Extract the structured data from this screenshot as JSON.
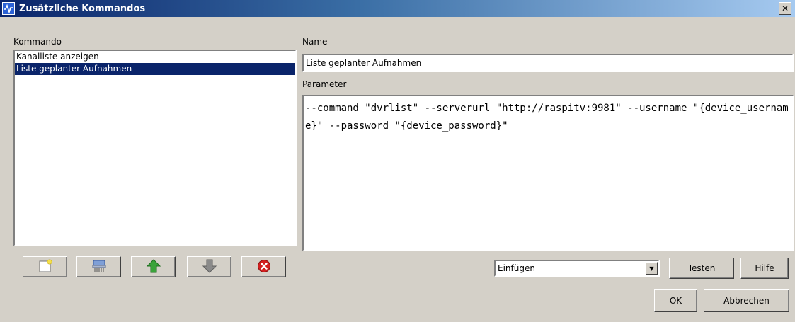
{
  "window": {
    "title": "Zusätzliche Kommandos",
    "close_glyph": "✕"
  },
  "commands": {
    "label": "Kommando",
    "items": [
      {
        "label": "Kanalliste anzeigen",
        "selected": false
      },
      {
        "label": "Liste geplanter Aufnahmen",
        "selected": true
      }
    ]
  },
  "name": {
    "label": "Name",
    "value": "Liste geplanter Aufnahmen"
  },
  "parameter": {
    "label": "Parameter",
    "value": "--command \"dvrlist\" --serverurl \"http://raspitv:9981\" --username \"{device_username}\" --password \"{device_password}\""
  },
  "toolbar": {
    "icons": [
      "new-document-icon",
      "shredder-icon",
      "arrow-up-icon",
      "arrow-down-icon",
      "delete-icon"
    ]
  },
  "insert_combo": {
    "value": "Einfügen",
    "arrow_glyph": "▼"
  },
  "buttons": {
    "test": "Testen",
    "help": "Hilfe",
    "ok": "OK",
    "cancel": "Abbrechen"
  },
  "colors": {
    "selection": "#0a246a",
    "dialog_bg": "#d4d0c8",
    "arrow_up": "#3aa33a",
    "arrow_down": "#8a8a8a",
    "delete": "#d32020"
  }
}
